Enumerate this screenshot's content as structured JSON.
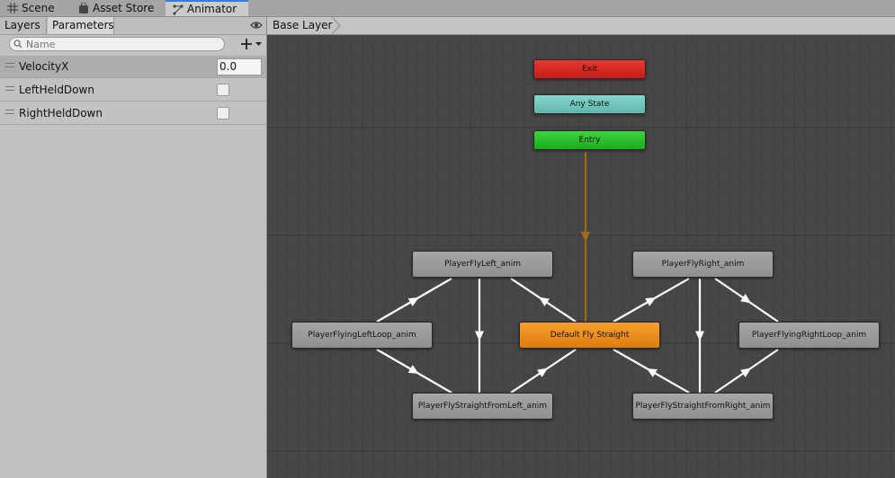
{
  "tabs": [
    {
      "label": "Scene",
      "icon": "grid-icon"
    },
    {
      "label": "Asset Store",
      "icon": "bag-icon"
    },
    {
      "label": "Animator",
      "icon": "animator-icon"
    }
  ],
  "left_panel": {
    "tabs": [
      "Layers",
      "Parameters"
    ],
    "search_placeholder": "Name",
    "parameters": [
      {
        "name": "VelocityX",
        "type": "float",
        "value": "0.0"
      },
      {
        "name": "LeftHeldDown",
        "type": "bool",
        "value": false
      },
      {
        "name": "RightHeldDown",
        "type": "bool",
        "value": false
      }
    ]
  },
  "graph": {
    "breadcrumb": "Base Layer",
    "states": {
      "exit": "Exit",
      "any": "Any State",
      "entry": "Entry",
      "left": "PlayerFlyLeft_anim",
      "right": "PlayerFlyRight_anim",
      "left_loop": "PlayerFlyingLeftLoop_anim",
      "default": "Default Fly Straight",
      "right_loop": "PlayerFlyingRightLoop_anim",
      "straight_left": "PlayerFlyStraightFromLeft_anim",
      "straight_right": "PlayerFlyStraightFromRight_anim"
    },
    "colors": {
      "exit": "#d9251f",
      "any": "#6fc6bc",
      "entry": "#27c227",
      "default": "#f08a17",
      "state": "#9a9a9a",
      "entry_link": "#a36a10",
      "link": "#ffffff"
    }
  }
}
